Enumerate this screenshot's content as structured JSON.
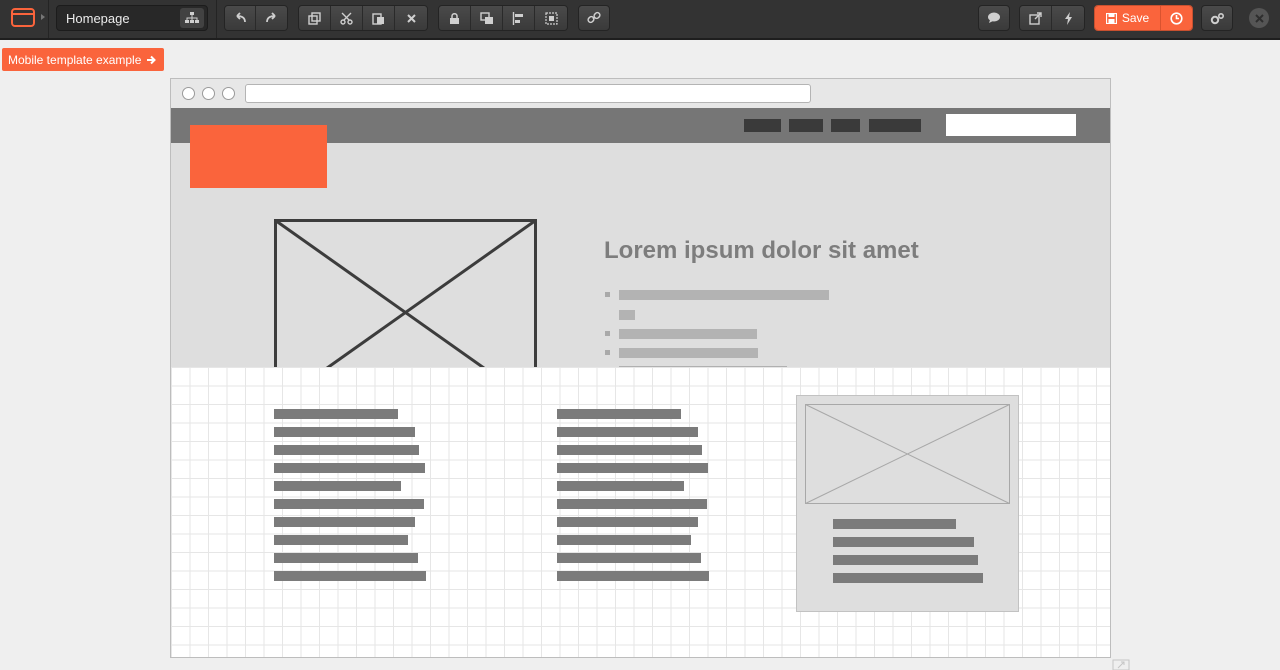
{
  "toolbar": {
    "page_name": "Homepage",
    "save_label": "Save",
    "icons": [
      "window-icon",
      "sitemap-icon",
      "undo-icon",
      "redo-icon",
      "duplicate-icon",
      "cut-icon",
      "paste-icon",
      "delete-icon",
      "lock-icon",
      "arrange-icon",
      "align-icon",
      "group-icon",
      "link-icon",
      "comment-icon",
      "export-icon",
      "flash-icon",
      "save-icon",
      "history-icon",
      "settings-icon",
      "close-icon"
    ]
  },
  "template_link": {
    "label": "Mobile template example",
    "icon": "arrow-right-icon"
  },
  "wireframe": {
    "hero_title": "Lorem ipsum dolor sit amet"
  },
  "colors": {
    "accent": "#fa643c",
    "toolbar_bg": "#333333",
    "canvas_bg": "#efefef",
    "wire_dark": "#3c3c3c",
    "wire_gray": "#a8a8a8"
  }
}
